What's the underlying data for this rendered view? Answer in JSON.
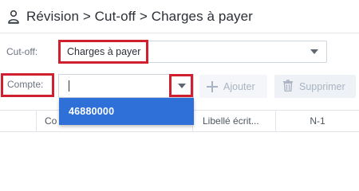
{
  "header": {
    "title": "Révision > Cut-off > Charges à payer",
    "icon": "user-settings-icon"
  },
  "cutoff": {
    "label": "Cut-off:",
    "selected": "Charges à payer"
  },
  "compte": {
    "label": "Compte:",
    "value": "",
    "options": [
      "46880000"
    ]
  },
  "toolbar": {
    "add_label": "Ajouter",
    "delete_label": "Supprimer"
  },
  "table": {
    "columns": [
      "",
      "Compte",
      "Libellé écriture",
      "N-1"
    ],
    "visible_columns": [
      "",
      "Co",
      "Libellé écrit...",
      "N-1"
    ]
  },
  "colors": {
    "highlight_red": "#d01f2f",
    "dropdown_blue": "#2f6fd8"
  }
}
